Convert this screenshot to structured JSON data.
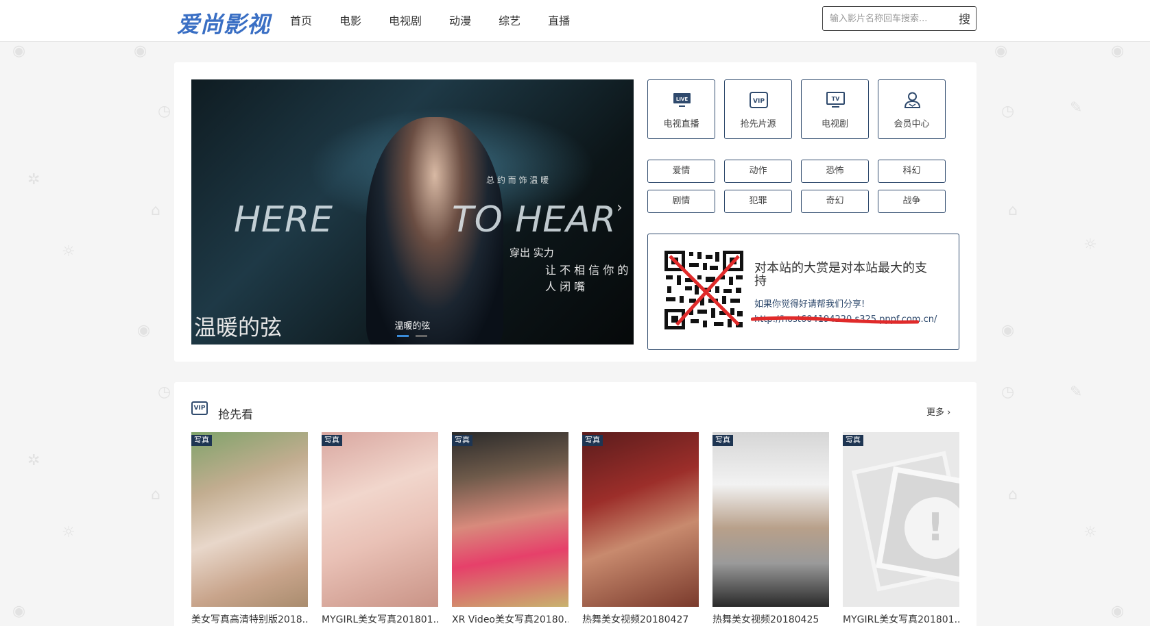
{
  "header": {
    "logo": "爱尚影视",
    "nav": [
      "首页",
      "电影",
      "电视剧",
      "动漫",
      "综艺",
      "直播"
    ],
    "search_placeholder": "输入影片名称回车搜索...",
    "search_button": "搜"
  },
  "banner": {
    "text_left": "HERE",
    "text_right": "TO HEAR",
    "line_top": "总 约 而 饰 温 暖",
    "line_a": "穿出 实力",
    "line_b": "让 不 相 信 你 的 人 闭 嘴",
    "corner_title": "温暖的弦",
    "caption": "温暖的弦",
    "next_arrow": "›"
  },
  "quick_links": [
    {
      "label": "电视直播",
      "icon": "live-tv-icon",
      "icon_text": "LIVE"
    },
    {
      "label": "抢先片源",
      "icon": "vip-icon",
      "icon_text": "VIP"
    },
    {
      "label": "电视剧",
      "icon": "tv-icon",
      "icon_text": "TV"
    },
    {
      "label": "会员中心",
      "icon": "user-icon",
      "icon_text": ""
    }
  ],
  "tags": [
    "爱情",
    "动作",
    "恐怖",
    "科幻",
    "剧情",
    "犯罪",
    "奇幻",
    "战争"
  ],
  "share": {
    "title": "对本站的大赏是对本站最大的支持",
    "subtitle": "如果你觉得好请帮我们分享!",
    "url": "http://host604194220.s325.pppf.com.cn/"
  },
  "section": {
    "icon_text": "VIP",
    "title": "抢先看",
    "more": "更多",
    "more_arrow": "›",
    "items": [
      {
        "badge": "写真",
        "title": "美女写真高清特别版2018...",
        "tone": "warm"
      },
      {
        "badge": "写真",
        "title": "MYGIRL美女写真201801...",
        "tone": "pink"
      },
      {
        "badge": "写真",
        "title": "XR Video美女写真20180...",
        "tone": "party"
      },
      {
        "badge": "写真",
        "title": "热舞美女视频20180427",
        "tone": "red"
      },
      {
        "badge": "写真",
        "title": "热舞美女视频20180425",
        "tone": "stage"
      },
      {
        "badge": "写真",
        "title": "MYGIRL美女写真201801...",
        "tone": "broken"
      }
    ]
  },
  "colors": {
    "accent": "#2f4a6d",
    "logo": "#3a6fc4",
    "active_dot": "#3a8bd8"
  }
}
